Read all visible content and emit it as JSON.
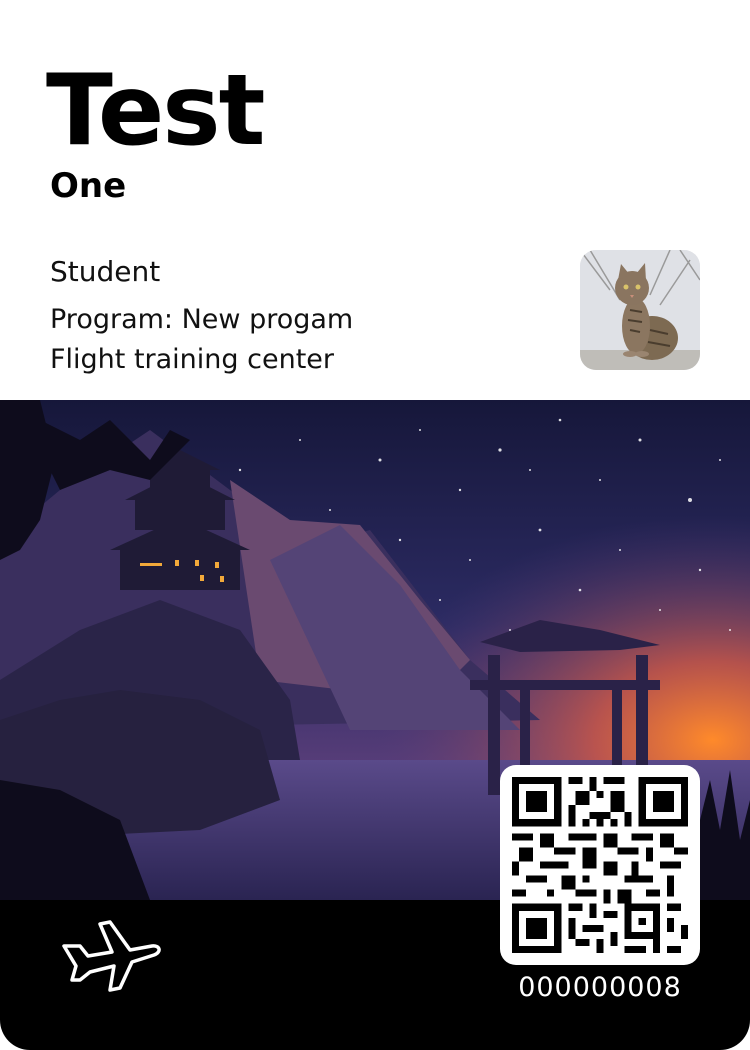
{
  "card": {
    "first_name": "Test",
    "last_name": "One",
    "role": "Student",
    "program": "Program: New progam",
    "center": "Flight training center",
    "number": "000000008"
  },
  "icons": {
    "photo": "cat-photo",
    "footer": "airplane-icon",
    "code": "qr-code"
  },
  "colors": {
    "sky_top": "#1c1d45",
    "sky_bottom": "#5a3e7a",
    "sunset": "#f07a2e",
    "footer": "#000000"
  }
}
